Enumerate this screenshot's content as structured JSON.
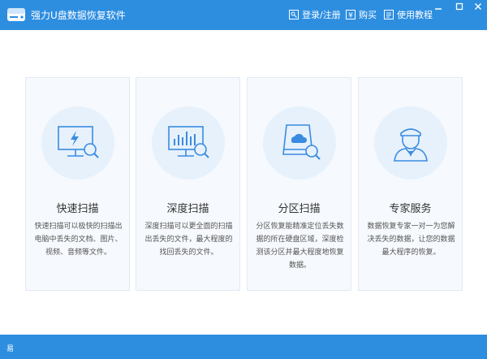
{
  "window": {
    "title": "强力U盘数据恢复软件",
    "links": {
      "login": "登录/注册",
      "buy": "购买",
      "tutorial": "使用教程"
    },
    "accent_color": "#2d8ee0"
  },
  "cards": [
    {
      "title": "快速扫描",
      "description": "快速扫描可以极快的扫描出电脑中丢失的文档、图片、视频、音频等文件。",
      "icon": "monitor-quick-scan-icon"
    },
    {
      "title": "深度扫描",
      "description": "深度扫描可以更全面的扫描出丢失的文件，最大程度的找回丢失的文件。",
      "icon": "monitor-chart-scan-icon"
    },
    {
      "title": "分区扫描",
      "description": "分区恢复能精准定位丢失数据的所在硬盘区域，深度检测该分区并最大程度地恢复数据。",
      "icon": "disk-partition-icon"
    },
    {
      "title": "专家服务",
      "description": "数据恢复专家一对一为您解决丢失的数据，让您的数据最大程序的恢复。",
      "icon": "expert-avatar-icon"
    }
  ],
  "status": {
    "text": "易"
  }
}
